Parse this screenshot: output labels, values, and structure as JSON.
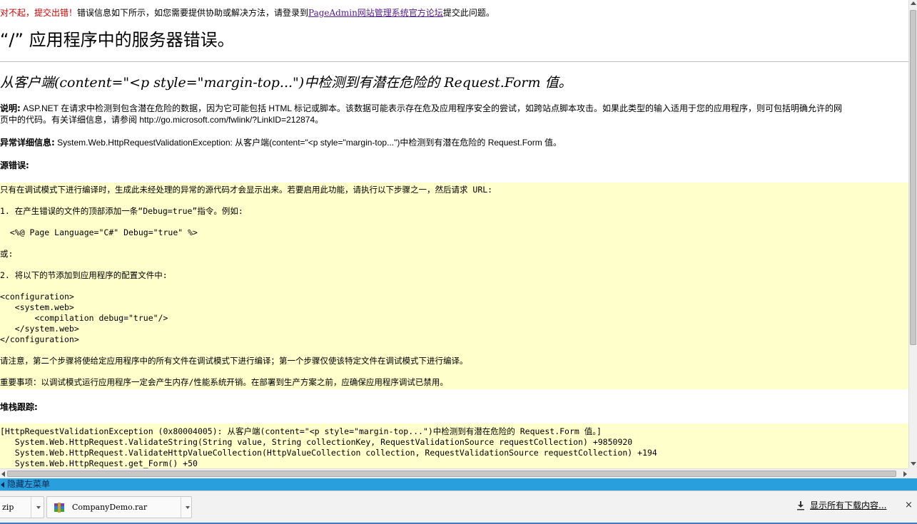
{
  "notice": {
    "prefix": "对不起，提交出错！",
    "body": "错误信息如下所示，如您需要提供协助或解决方法，请登录到",
    "link": "PageAdmin网站管理系统官方论坛",
    "suffix": "提交此问题。"
  },
  "page_title": "“/” 应用程序中的服务器错误。",
  "error_title": "从客户端(content=\"<p style=\"margin-top...\")中检测到有潜在危险的 Request.Form 值。",
  "description": {
    "label": "说明:",
    "text_line1": " ASP.NET 在请求中检测到包含潜在危险的数据，因为它可能包括 HTML 标记或脚本。该数据可能表示存在危及应用程序安全的尝试，如跨站点脚本攻击。如果此类型的输入适用于您的应用程序，则可包括明确允许的网",
    "text_line2": "页中的代码。有关详细信息，请参阅 ",
    "link": "http://go.microsoft.com/fwlink/?LinkID=212874",
    "end": "。"
  },
  "exception": {
    "label": "异常详细信息:",
    "text": " System.Web.HttpRequestValidationException: 从客户端(content=\"<p style=\"margin-top...\")中检测到有潜在危险的 Request.Form 值。"
  },
  "source_error": {
    "label": "源错误:",
    "lines": [
      "只有在调试模式下进行编译时，生成此未经处理的异常的源代码才会显示出来。若要启用此功能，请执行以下步骤之一，然后请求 URL:",
      "1. 在产生错误的文件的顶部添加一条“Debug=true”指令。例如:",
      "  <%@ Page Language=\"C#\" Debug=\"true\" %>",
      "或:",
      "2. 将以下的节添加到应用程序的配置文件中:",
      "<configuration>",
      "   <system.web>",
      "       <compilation debug=\"true\"/>",
      "   </system.web>",
      "</configuration>",
      "请注意，第二个步骤将使给定应用程序中的所有文件在调试模式下进行编译；第一个步骤仅使该特定文件在调试模式下进行编译。",
      "重要事项：以调试模式运行应用程序一定会产生内存/性能系统开销。在部署到生产方案之前，应确保应用程序调试已禁用。"
    ]
  },
  "stack_trace": {
    "label": "堆栈跟踪:",
    "lines": [
      "[HttpRequestValidationException (0x80004005): 从客户端(content=\"<p style=\"margin-top...\")中检测到有潜在危险的 Request.Form 值。]",
      "   System.Web.HttpRequest.ValidateString(String value, String collectionKey, RequestValidationSource requestCollection) +9850920",
      "   System.Web.HttpRequest.ValidateHttpValueCollection(HttpValueCollection collection, RequestValidationSource requestCollection) +194",
      "   System.Web.HttpRequest.get_Form() +50"
    ]
  },
  "menu_bar": {
    "label": "隐藏左菜单",
    "color": "#2a9fde"
  },
  "downloads": {
    "items": [
      {
        "name": "zip",
        "icon": "zip-file-icon"
      },
      {
        "name": "CompanyDemo.rar",
        "icon": "rar-archive-icon"
      }
    ],
    "show_all": "显示所有下载内容...",
    "close": "×"
  },
  "colors": {
    "code_bg": "#ffffcc",
    "notice_red": "#d40000",
    "link_purple": "#551a8b"
  }
}
